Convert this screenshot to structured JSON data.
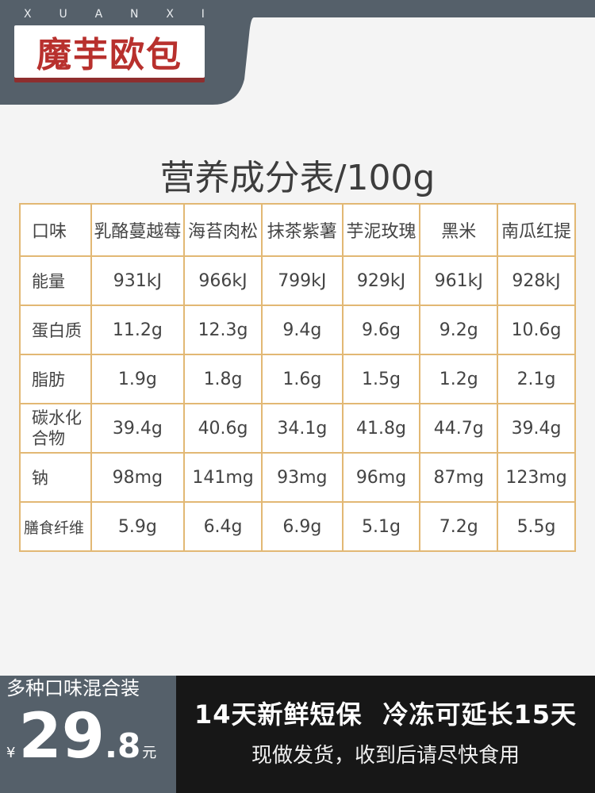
{
  "brand": {
    "letters": [
      "X",
      "U",
      "A",
      "N",
      "X",
      "I"
    ],
    "title": "魔芋欧包"
  },
  "colors": {
    "background": "#55606a",
    "card": "#f4f4f4",
    "title_red": "#b8302d",
    "table_border": "#e2b874",
    "promo_bg": "#171717"
  },
  "table": {
    "title": "营养成分表/100g",
    "header": [
      "口味",
      "乳酪蔓越莓",
      "海苔肉松",
      "抹茶紫薯",
      "芋泥玫瑰",
      "黑米",
      "南瓜红提"
    ],
    "rows": [
      {
        "label": "能量",
        "values": [
          "931kJ",
          "966kJ",
          "799kJ",
          "929kJ",
          "961kJ",
          "928kJ"
        ]
      },
      {
        "label": "蛋白质",
        "values": [
          "11.2g",
          "12.3g",
          "9.4g",
          "9.6g",
          "9.2g",
          "10.6g"
        ]
      },
      {
        "label": "脂肪",
        "values": [
          "1.9g",
          "1.8g",
          "1.6g",
          "1.5g",
          "1.2g",
          "2.1g"
        ]
      },
      {
        "label": "碳水化合物",
        "values": [
          "39.4g",
          "40.6g",
          "34.1g",
          "41.8g",
          "44.7g",
          "39.4g"
        ]
      },
      {
        "label": "钠",
        "values": [
          "98mg",
          "141mg",
          "93mg",
          "96mg",
          "87mg",
          "123mg"
        ]
      },
      {
        "label": "膳食纤维",
        "values": [
          "5.9g",
          "6.4g",
          "6.9g",
          "5.1g",
          "7.2g",
          "5.5g"
        ]
      }
    ]
  },
  "footer": {
    "mix_label": "多种口味混合装",
    "price": {
      "currency": "¥",
      "integer": "29",
      "decimal": ".8",
      "unit": "元"
    },
    "promo_line1_a": "14天新鲜短保",
    "promo_line1_b": "冷冻可延长15天",
    "promo_line2": "现做发货，收到后请尽快食用"
  }
}
